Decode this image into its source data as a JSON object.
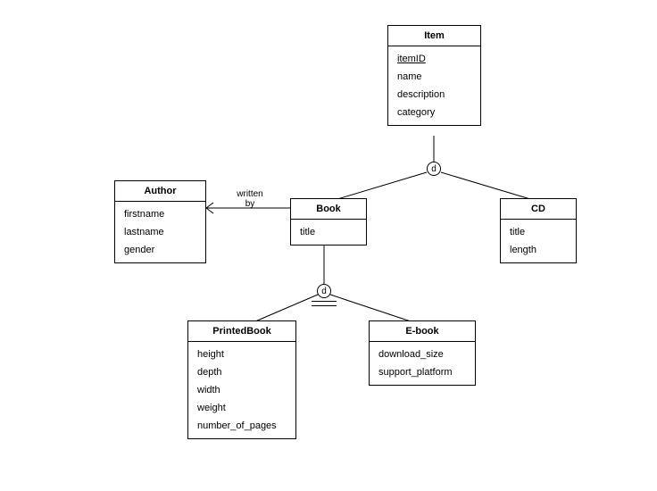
{
  "entities": {
    "item": {
      "name": "Item",
      "attributes": [
        "itemID",
        "name",
        "description",
        "category"
      ],
      "keys": [
        "itemID"
      ]
    },
    "author": {
      "name": "Author",
      "attributes": [
        "firstname",
        "lastname",
        "gender"
      ],
      "keys": []
    },
    "book": {
      "name": "Book",
      "attributes": [
        "title"
      ],
      "keys": []
    },
    "cd": {
      "name": "CD",
      "attributes": [
        "title",
        "length"
      ],
      "keys": []
    },
    "printedbook": {
      "name": "PrintedBook",
      "attributes": [
        "height",
        "depth",
        "width",
        "weight",
        "number_of_pages"
      ],
      "keys": []
    },
    "ebook": {
      "name": "E-book",
      "attributes": [
        "download_size",
        "support_platform"
      ],
      "keys": []
    }
  },
  "disjoint_label": "d",
  "relationships": {
    "written_by": {
      "label_line1": "written",
      "label_line2": "by"
    }
  },
  "hierarchy": {
    "item_children": [
      "book",
      "cd"
    ],
    "book_children": [
      "printedbook",
      "ebook"
    ]
  }
}
